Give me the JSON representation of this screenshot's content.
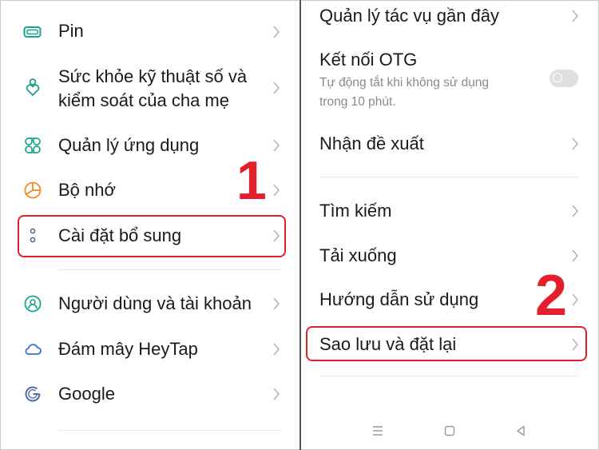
{
  "left": {
    "items": [
      {
        "label": "Pin"
      },
      {
        "label_line1": "Sức khỏe kỹ thuật số và",
        "label_line2": "kiểm soát của cha mẹ"
      },
      {
        "label": "Quản lý ứng dụng"
      },
      {
        "label": "Bộ nhớ"
      },
      {
        "label": "Cài đặt bổ sung"
      },
      {
        "label": "Người dùng và tài khoản"
      },
      {
        "label": "Đám mây HeyTap"
      },
      {
        "label": "Google"
      }
    ],
    "step_number": "1"
  },
  "right": {
    "items": [
      {
        "label": "Quản lý tác vụ gần đây"
      },
      {
        "label": "Kết nối OTG",
        "sub_line1": "Tự động tắt khi không sử dụng",
        "sub_line2": "trong 10 phút."
      },
      {
        "label": "Nhận đề xuất"
      },
      {
        "label": "Tìm kiếm"
      },
      {
        "label": "Tải xuống"
      },
      {
        "label": "Hướng dẫn sử dụng"
      },
      {
        "label": "Sao lưu và đặt lại"
      }
    ],
    "otg_toggle_on": false,
    "step_number": "2"
  },
  "colors": {
    "accent_icon": "#17a38c",
    "highlight": "#e41e2b"
  },
  "icons": [
    "battery-icon",
    "digital-wellbeing-icon",
    "app-management-icon",
    "storage-icon",
    "more-settings-icon",
    "user-accounts-icon",
    "cloud-icon",
    "google-icon",
    "menu-nav-icon",
    "home-nav-icon",
    "back-nav-icon"
  ]
}
